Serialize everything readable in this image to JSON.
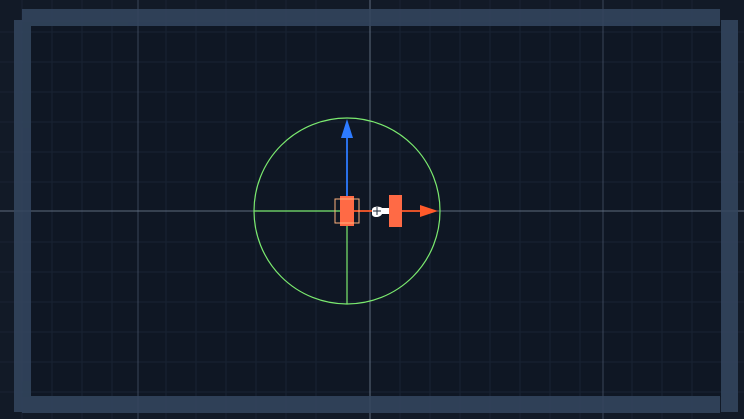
{
  "scene_view": {
    "background_color": "#121a27",
    "frame_color": "#33465e",
    "major_grid_color": "#55657a",
    "minor_grid_color": "#1b2535",
    "origin_axis_color": "#6b7a8d",
    "show_grid": true
  },
  "gizmo": {
    "circle_color": "#7bea6f",
    "x_axis_color": "#ff5a2a",
    "y_axis_color": "#2d7bff",
    "selected_handle_color": "#ff6a45",
    "icons": [
      "move-gizmo-icon",
      "x-axis-arrow-icon",
      "y-axis-arrow-icon",
      "hand-cursor-icon"
    ]
  }
}
